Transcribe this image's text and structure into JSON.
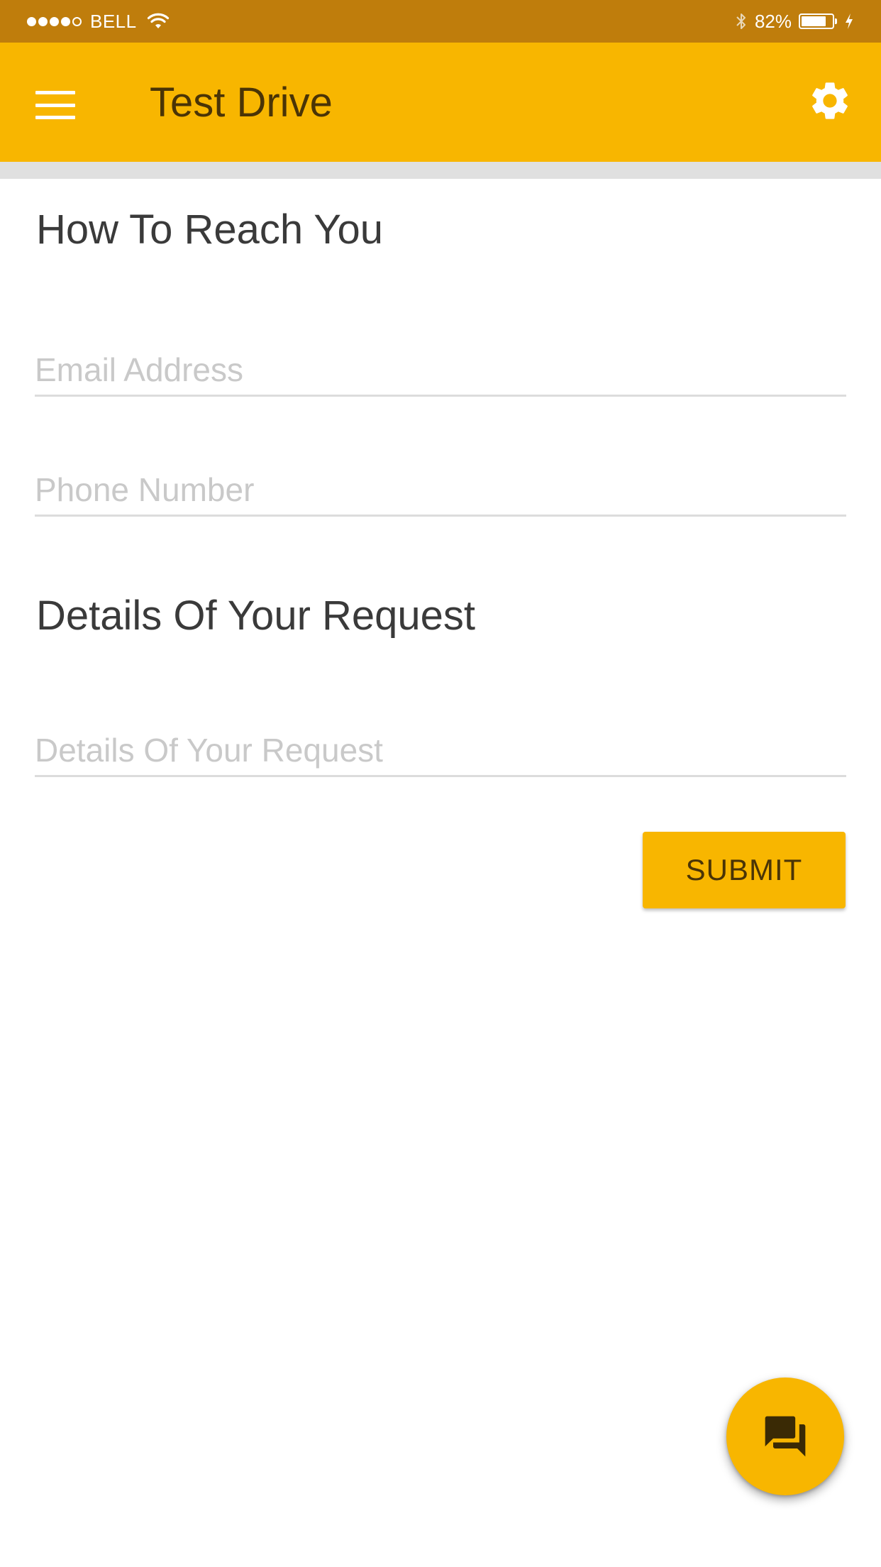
{
  "status_bar": {
    "carrier": "BELL",
    "battery_percent": "82%",
    "battery_level": 0.82,
    "signal_bars_filled": 4,
    "signal_bars_total": 5
  },
  "app_bar": {
    "title": "Test Drive",
    "menu_icon": "hamburger-menu-icon",
    "settings_icon": "gear-icon"
  },
  "sections": {
    "contact_heading": "How To Reach You",
    "request_heading": "Details Of Your Request"
  },
  "fields": {
    "email": {
      "value": "",
      "placeholder": "Email Address"
    },
    "phone": {
      "value": "",
      "placeholder": "Phone Number"
    },
    "details": {
      "value": "",
      "placeholder": "Details Of Your Request"
    }
  },
  "actions": {
    "submit_label": "SUBMIT",
    "fab_icon": "chat-icon"
  },
  "colors": {
    "status_bar": "#bf7d0c",
    "accent": "#f8b600",
    "title_text": "#4a3406",
    "heading_text": "#3a3a3a",
    "placeholder_text": "#c9c9c9"
  }
}
